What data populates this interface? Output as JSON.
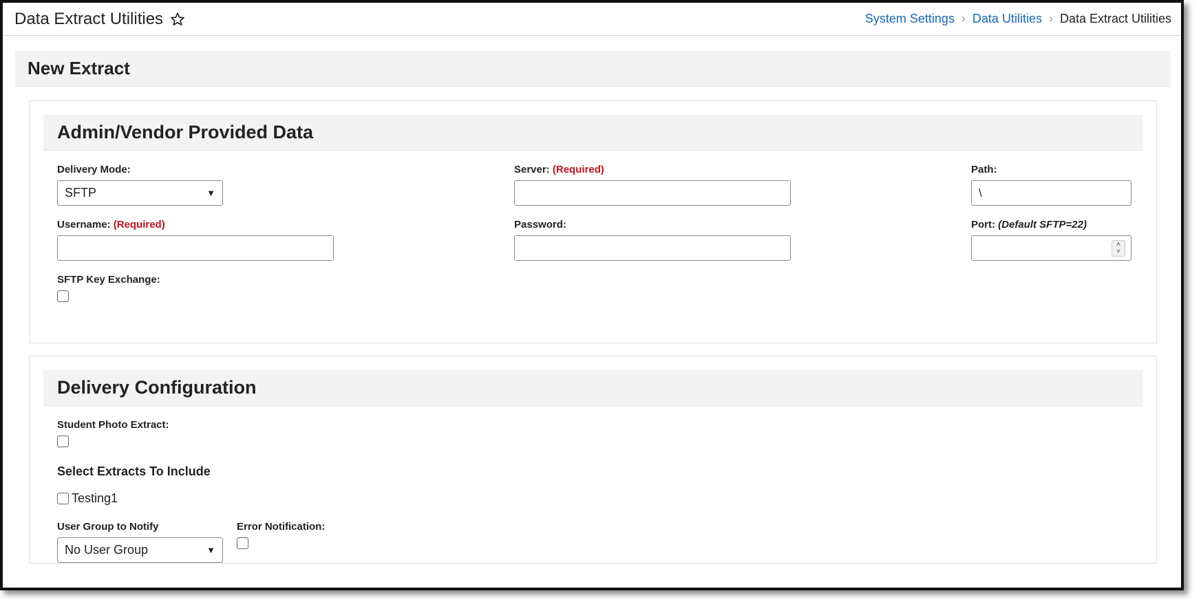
{
  "app": {
    "title": "Data Extract Utilities",
    "favorite_icon": "star-outline-icon"
  },
  "breadcrumb": {
    "items": [
      "System Settings",
      "Data Utilities"
    ],
    "current": "Data Extract Utilities",
    "separator": ">"
  },
  "page": {
    "title": "New Extract"
  },
  "admin_panel": {
    "title": "Admin/Vendor Provided Data",
    "delivery_mode": {
      "label": "Delivery Mode:",
      "value": "SFTP"
    },
    "server": {
      "label": "Server:",
      "required": "(Required)",
      "value": ""
    },
    "path": {
      "label": "Path:",
      "value": "\\"
    },
    "username": {
      "label": "Username:",
      "required": "(Required)",
      "value": ""
    },
    "password": {
      "label": "Password:",
      "value": ""
    },
    "port": {
      "label": "Port:",
      "hint": "(Default SFTP=22)",
      "value": ""
    },
    "sftp_key": {
      "label": "SFTP Key Exchange:",
      "checked": false
    }
  },
  "delivery_panel": {
    "title": "Delivery Configuration",
    "student_photo": {
      "label": "Student Photo Extract:",
      "checked": false
    },
    "extracts_heading": "Select Extracts To Include",
    "extracts": [
      {
        "label": "Testing1",
        "checked": false
      }
    ],
    "user_group": {
      "label": "User Group to Notify",
      "value": "No User Group"
    },
    "error_notification": {
      "label": "Error Notification:",
      "checked": false
    }
  },
  "colors": {
    "link": "#1a66b5",
    "required": "#c0121e",
    "header_bg": "#f3f3f3"
  }
}
